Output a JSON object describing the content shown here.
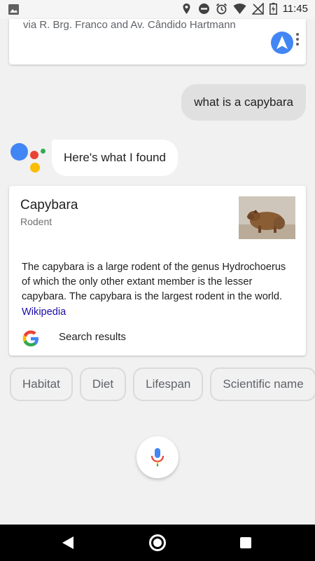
{
  "status_bar": {
    "time": "11:45",
    "icons": [
      "image-icon",
      "location-icon",
      "do-not-disturb-icon",
      "alarm-icon",
      "wifi-icon",
      "no-signal-icon",
      "battery-charging-icon"
    ]
  },
  "route_card": {
    "text": "via R. Brg. Franco and Av. Cândido Hartmann",
    "accent": "#4285f4"
  },
  "conversation": {
    "user_query": "what is a capybara",
    "assistant_reply": "Here's what I found"
  },
  "knowledge_card": {
    "title": "Capybara",
    "subtitle": "Rodent",
    "description": "The capybara is a large rodent of the genus Hydrochoerus of which the only other extant member is the lesser capybara. The capybara is the largest rodent in the world.",
    "source_link": "Wikipedia",
    "search_label": "Search results",
    "link_color": "#1a0dab"
  },
  "suggestion_chips": [
    {
      "label": "Habitat"
    },
    {
      "label": "Diet"
    },
    {
      "label": "Lifespan"
    },
    {
      "label": "Scientific name"
    }
  ],
  "assistant_colors": {
    "blue": "#4285f4",
    "red": "#ea4335",
    "yellow": "#fbbc05",
    "green": "#34a853"
  }
}
